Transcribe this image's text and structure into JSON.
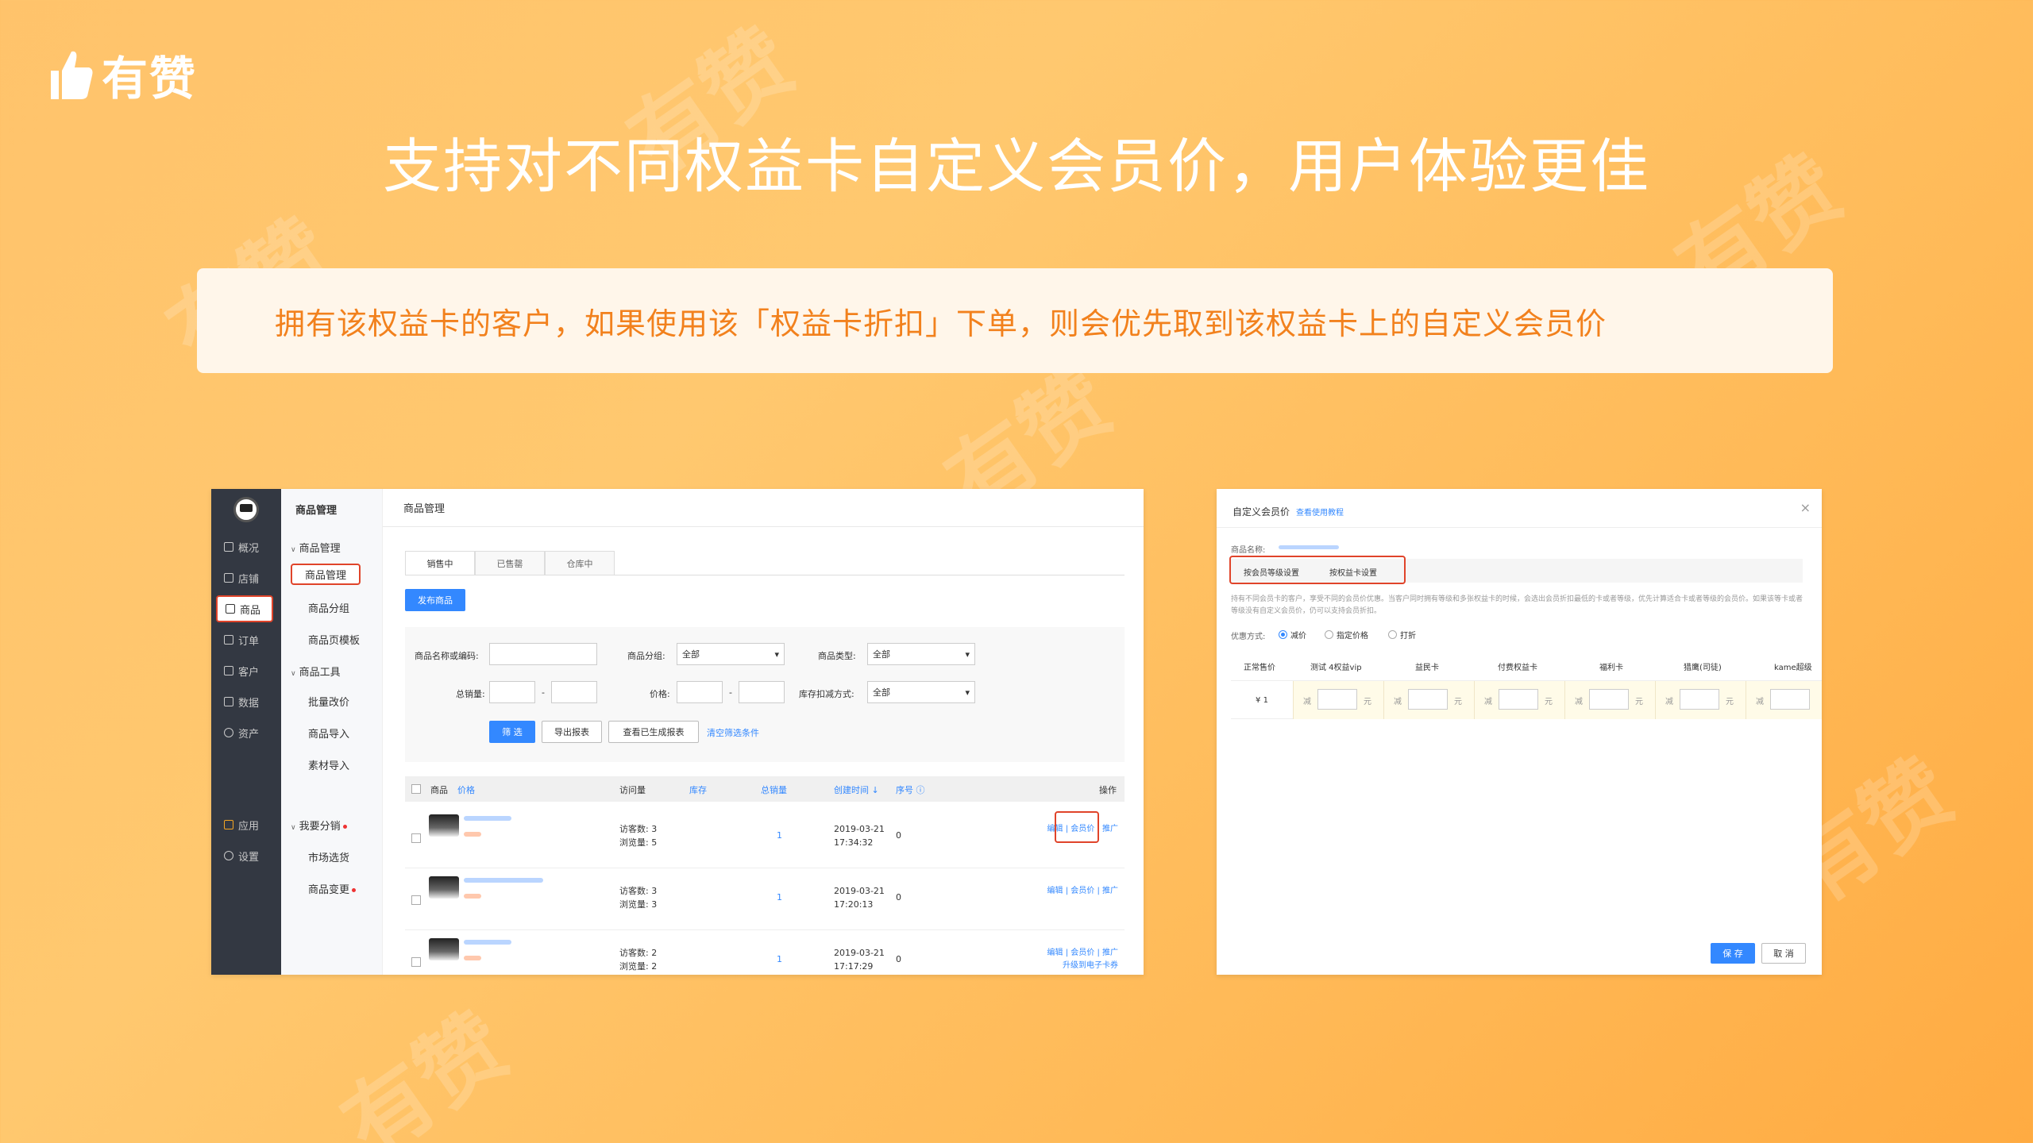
{
  "brand": {
    "name": "有赞",
    "watermark": "有赞"
  },
  "headline": "支持对不同权益卡自定义会员价，用户体验更佳",
  "banner": "拥有该权益卡的客户，如果使用该「权益卡折扣」下单，则会优先取到该权益卡上的自定义会员价",
  "colors": {
    "accent": "#f2811d",
    "link": "#3388ff",
    "highlight": "#e0442a"
  },
  "left_shot": {
    "nav": [
      "概况",
      "店铺",
      "商品",
      "订单",
      "客户",
      "数据",
      "资产",
      "应用",
      "设置"
    ],
    "sub_title": "商品管理",
    "sub_items": {
      "g1": "商品管理",
      "active": "商品管理",
      "group": "商品分组",
      "template": "商品页模板",
      "g2": "商品工具",
      "batch": "批量改价",
      "import": "商品导入",
      "material": "素材导入",
      "g3": "我要分销",
      "market": "市场选货",
      "change": "商品变更"
    },
    "header": "商品管理",
    "tabs": [
      "销售中",
      "已售罄",
      "仓库中"
    ],
    "publish": "发布商品",
    "filter": {
      "name_label": "商品名称或编码:",
      "group_label": "商品分组:",
      "group_value": "全部",
      "type_label": "商品类型:",
      "type_value": "全部",
      "sales_label": "总销量:",
      "price_label": "价格:",
      "dash": "-",
      "stock_label": "库存扣减方式:",
      "stock_value": "全部",
      "filter_btn": "筛 选",
      "export_btn": "导出报表",
      "view_btn": "查看已生成报表",
      "clear_link": "清空筛选条件"
    },
    "table_head": {
      "product": "商品",
      "price": "价格",
      "visits": "访问量",
      "stock": "库存",
      "sales": "总销量",
      "created": "创建时间 ↓",
      "seq": "序号 ⓘ",
      "ops": "操作"
    },
    "rows": [
      {
        "visitors": "访客数: 3",
        "views": "浏览量: 5",
        "sales": "1",
        "date": "2019-03-21",
        "time": "17:34:32",
        "seq": "0",
        "ops": "编辑 | 会员价 | 推广",
        "extra": ""
      },
      {
        "visitors": "访客数: 3",
        "views": "浏览量: 3",
        "sales": "1",
        "date": "2019-03-21",
        "time": "17:20:13",
        "seq": "0",
        "ops": "编辑 | 会员价 | 推广",
        "extra": ""
      },
      {
        "visitors": "访客数: 2",
        "views": "浏览量: 2",
        "sales": "1",
        "date": "2019-03-21",
        "time": "17:17:29",
        "seq": "0",
        "ops": "编辑 | 会员价 | 推广",
        "extra": "升级到电子卡券"
      }
    ]
  },
  "right_shot": {
    "title": "自定义会员价",
    "help_link": "查看使用教程",
    "close": "×",
    "product_label": "商品名称:",
    "seg_level": "按会员等级设置",
    "seg_card": "按权益卡设置",
    "note": "持有不同会员卡的客户，享受不同的会员价优惠。当客户同时拥有等级和多张权益卡的时候，会选出会员折扣最低的卡或者等级，优先计算适合卡或者等级的会员价。如果该等卡或者等级没有自定义会员价，仍可以支持会员折扣。",
    "mode_label": "优惠方式:",
    "modes": [
      "减价",
      "指定价格",
      "打折"
    ],
    "columns": [
      "正常售价",
      "测试 4权益vip",
      "益民卡",
      "付费权益卡",
      "福利卡",
      "猎鹰(司徒)",
      "kame超级"
    ],
    "normal_price": "¥ 1",
    "minus": "减",
    "unit": "元",
    "save": "保 存",
    "cancel": "取 消"
  }
}
